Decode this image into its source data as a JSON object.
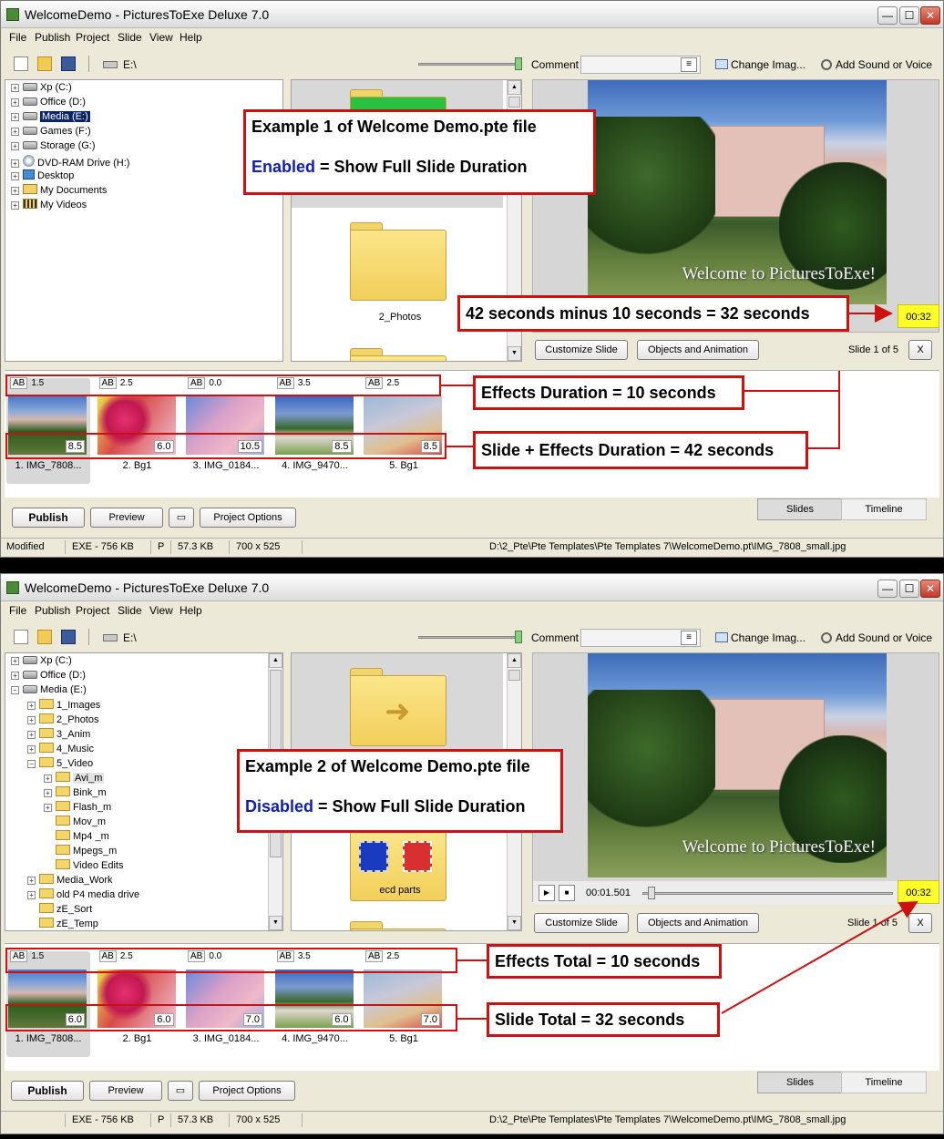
{
  "window": {
    "title": "WelcomeDemo - PicturesToExe Deluxe 7.0",
    "min_glyph": "—",
    "max_glyph": "☐",
    "close_glyph": "✕"
  },
  "menu": [
    "File",
    "Publish",
    "Project",
    "Slide",
    "View",
    "Help"
  ],
  "toolbar": {
    "drive_label": "E:\\",
    "comment_label": "Comment",
    "change_image": "Change Imag...",
    "add_sound": "Add Sound or Voice",
    "icons": [
      "new-file-icon",
      "open-folder-icon",
      "save-icon",
      "drive-icon",
      "comment-edit-icon",
      "change-image-icon",
      "speaker-icon"
    ]
  },
  "colors": {
    "annotation_red": "#cc1111",
    "accent_blue": "#1020b0",
    "time_yellow": "#ffff2a",
    "tree_selection": "#0a246a"
  },
  "tree1": [
    {
      "label": "Xp (C:)",
      "icon": "drive-icon"
    },
    {
      "label": "Office (D:)",
      "icon": "drive-icon"
    },
    {
      "label": "Media (E:)",
      "icon": "drive-icon",
      "selected": true
    },
    {
      "label": "Games (F:)",
      "icon": "drive-icon"
    },
    {
      "label": "Storage (G:)",
      "icon": "drive-icon"
    },
    {
      "label": "DVD-RAM Drive (H:)",
      "icon": "dvd-icon"
    },
    {
      "label": "Desktop",
      "icon": "desktop-icon"
    },
    {
      "label": "My Documents",
      "icon": "documents-icon"
    },
    {
      "label": "My Videos",
      "icon": "videos-icon"
    }
  ],
  "tree2": [
    {
      "label": "Xp (C:)",
      "icon": "drive-icon"
    },
    {
      "label": "Office (D:)",
      "icon": "drive-icon"
    },
    {
      "label": "Media (E:)",
      "icon": "drive-icon"
    },
    {
      "label": "1_Images",
      "icon": "folder-icon"
    },
    {
      "label": "2_Photos",
      "icon": "folder-icon"
    },
    {
      "label": "3_Anim",
      "icon": "folder-icon"
    },
    {
      "label": "4_Music",
      "icon": "folder-icon"
    },
    {
      "label": "5_Video",
      "icon": "folder-icon"
    },
    {
      "label": "Avi_m",
      "icon": "folder-icon",
      "highlighted": true
    },
    {
      "label": "Bink_m",
      "icon": "folder-icon"
    },
    {
      "label": "Flash_m",
      "icon": "folder-icon"
    },
    {
      "label": "Mov_m",
      "icon": "folder-icon"
    },
    {
      "label": "Mp4 _m",
      "icon": "folder-icon"
    },
    {
      "label": "Mpegs_m",
      "icon": "folder-icon"
    },
    {
      "label": "Video Edits",
      "icon": "folder-icon"
    },
    {
      "label": "Media_Work",
      "icon": "folder-icon"
    },
    {
      "label": "old P4 media drive",
      "icon": "folder-icon"
    },
    {
      "label": "zE_Sort",
      "icon": "folder-icon"
    },
    {
      "label": "zE_Temp",
      "icon": "folder-icon"
    }
  ],
  "files1": [
    "2_Photos"
  ],
  "files2": [
    "ecd parts"
  ],
  "preview": {
    "caption": "Welcome to PicturesToExe!",
    "time": "00:32",
    "position": "00:01.501",
    "slide_of": "Slide 1 of 5",
    "close": "X"
  },
  "buttons": {
    "customize": "Customize Slide",
    "objects": "Objects and Animation",
    "publish": "Publish",
    "preview": "Preview",
    "project_options": "Project Options"
  },
  "tabs": {
    "slides": "Slides",
    "timeline": "Timeline"
  },
  "ab_label": "AB",
  "slides1": [
    {
      "effect": "1.5",
      "duration": "8.5",
      "caption": "1. IMG_7808..."
    },
    {
      "effect": "2.5",
      "duration": "6.0",
      "caption": "2. Bg1"
    },
    {
      "effect": "0.0",
      "duration": "10.5",
      "caption": "3. IMG_0184..."
    },
    {
      "effect": "3.5",
      "duration": "8.5",
      "caption": "4. IMG_9470..."
    },
    {
      "effect": "2.5",
      "duration": "8.5",
      "caption": "5. Bg1"
    }
  ],
  "slides2": [
    {
      "effect": "1.5",
      "duration": "6.0",
      "caption": "1. IMG_7808..."
    },
    {
      "effect": "2.5",
      "duration": "6.0",
      "caption": "2. Bg1"
    },
    {
      "effect": "0.0",
      "duration": "7.0",
      "caption": "3. IMG_0184..."
    },
    {
      "effect": "3.5",
      "duration": "6.0",
      "caption": "4. IMG_9470..."
    },
    {
      "effect": "2.5",
      "duration": "7.0",
      "caption": "5. Bg1"
    }
  ],
  "status": {
    "modified": "Modified",
    "exe": "EXE - 756 KB",
    "p": "P",
    "size": "57.3 KB",
    "dims": "700 x 525",
    "path": "D:\\2_Pte\\Pte Templates\\Pte Templates 7\\WelcomeDemo.pt\\IMG_7808_small.jpg"
  },
  "annotations": {
    "ex1_title": "Example 1 of Welcome Demo.pte file",
    "ex1_word": "Enabled",
    "ex1_rest": " = Show Full Slide Duration",
    "ex1_minus": "42 seconds minus 10 seconds = 32 seconds",
    "ex1_effects": "Effects Duration = 10 seconds",
    "ex1_total": "Slide + Effects Duration = 42 seconds",
    "ex2_title": "Example 2 of Welcome Demo.pte file",
    "ex2_word": "Disabled",
    "ex2_rest": " = Show Full Slide Duration",
    "ex2_effects": "Effects Total = 10 seconds",
    "ex2_slide": "Slide Total = 32 seconds"
  }
}
